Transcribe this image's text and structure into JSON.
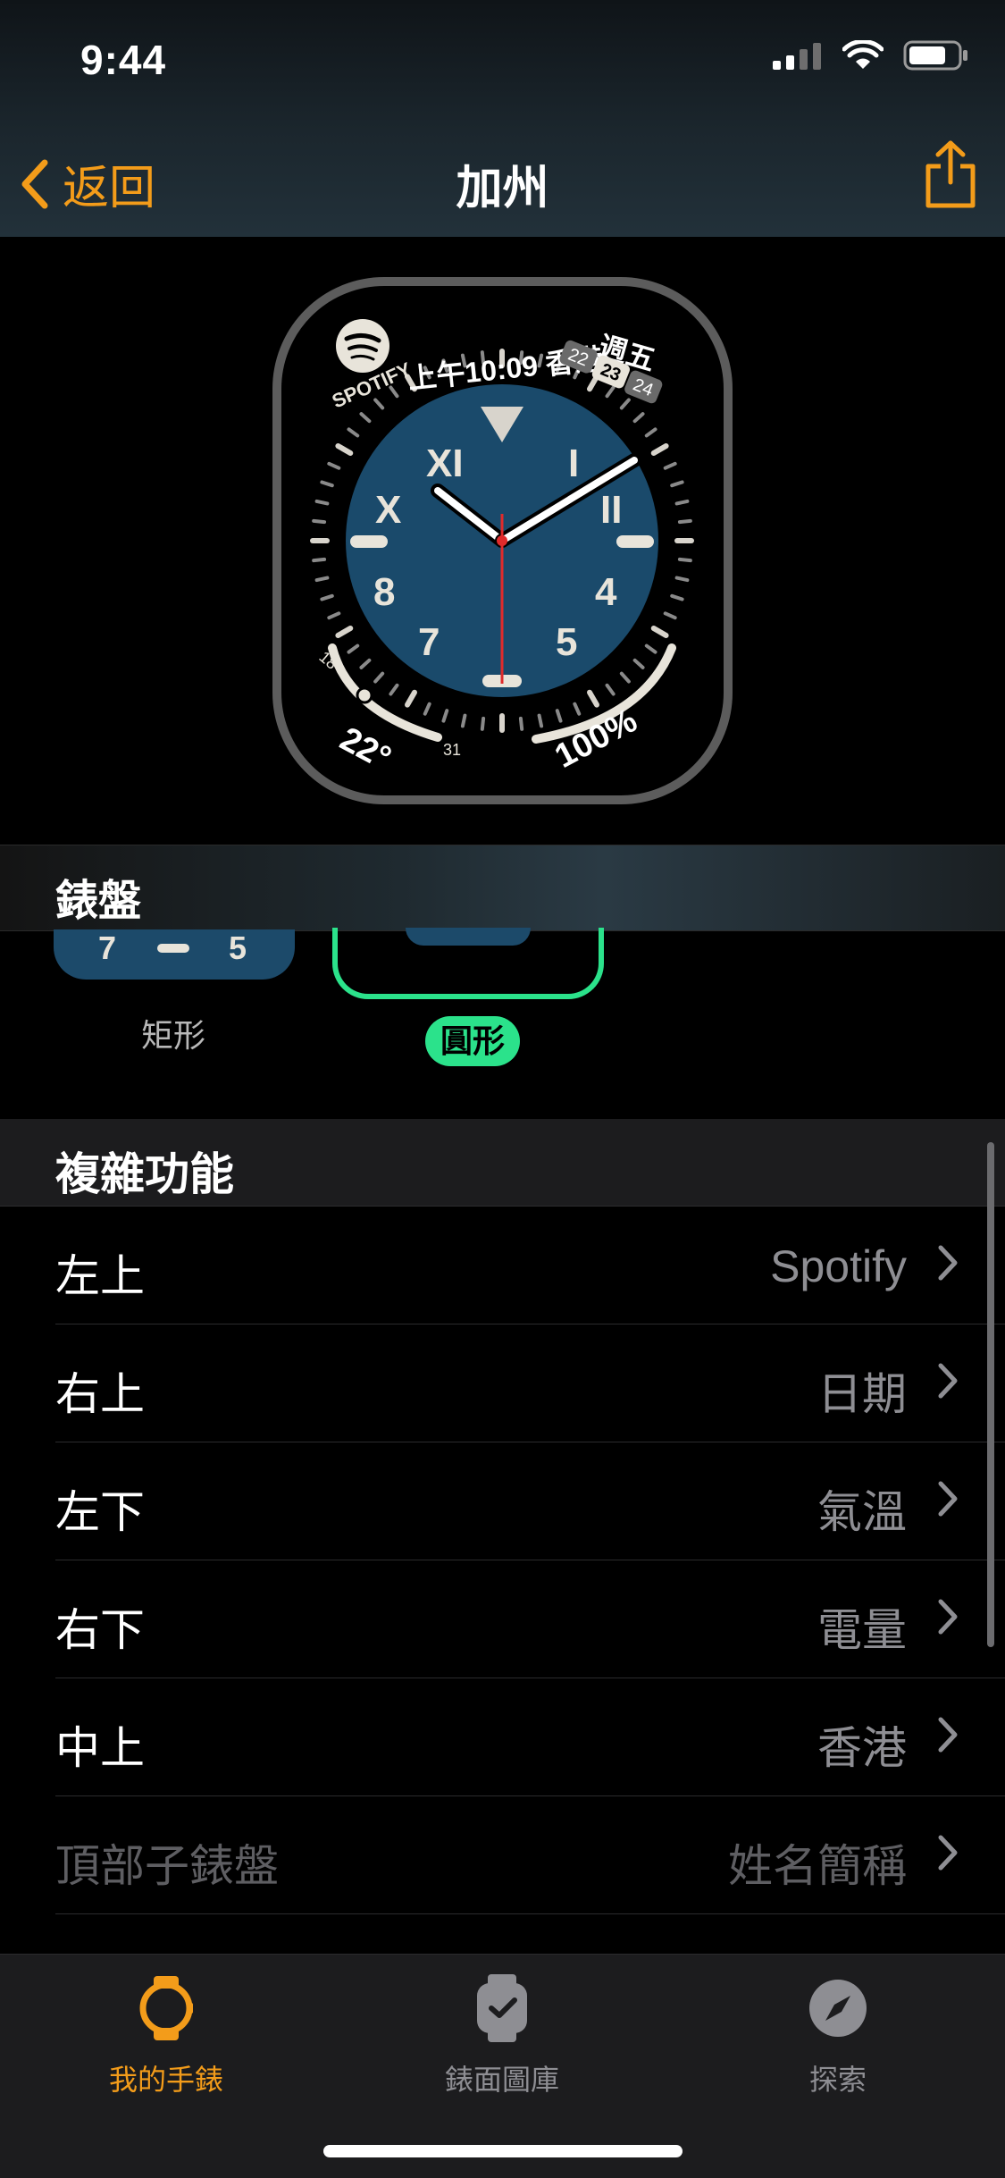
{
  "status_bar": {
    "time": "9:44"
  },
  "nav": {
    "back_label": "返回",
    "title": "加州"
  },
  "watch_face": {
    "top_left_complication": "SPOTIFY",
    "time_text": "上午10:09 香港",
    "weekday": "週五",
    "dates": [
      "22",
      "23",
      "24"
    ],
    "numerals": [
      "XI",
      "I",
      "X",
      "II",
      "8",
      "4",
      "7",
      "5"
    ],
    "temperature": "22°",
    "temp_low": "18",
    "temp_high": "31",
    "battery": "100%",
    "dial_color": "#1a4a6b",
    "accent_color": "#e02b2b"
  },
  "dial_section": {
    "header": "錶盤",
    "style_options": [
      {
        "label": "矩形",
        "selected": false,
        "numerals": [
          "7",
          "5"
        ]
      },
      {
        "label": "圓形",
        "selected": true
      }
    ]
  },
  "complications": {
    "header": "複雜功能",
    "rows": [
      {
        "name": "左上",
        "value": "Spotify"
      },
      {
        "name": "右上",
        "value": "日期"
      },
      {
        "name": "左下",
        "value": "氣溫"
      },
      {
        "name": "右下",
        "value": "電量"
      },
      {
        "name": "中上",
        "value": "香港"
      },
      {
        "name": "頂部子錶盤",
        "value": "姓名簡稱"
      }
    ]
  },
  "tab_bar": {
    "items": [
      {
        "label": "我的手錶",
        "icon": "watch-icon",
        "active": true
      },
      {
        "label": "錶面圖庫",
        "icon": "face-gallery-icon",
        "active": false
      },
      {
        "label": "探索",
        "icon": "compass-icon",
        "active": false
      }
    ],
    "active_color": "#f39c1a",
    "inactive_color": "#8e8e93"
  }
}
